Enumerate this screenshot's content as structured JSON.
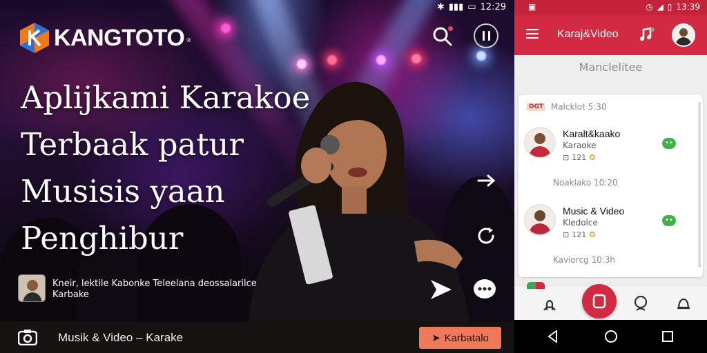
{
  "status_bar_left": {
    "time": "12:29"
  },
  "brand": {
    "name": "KANGTOTO",
    "mark": "®"
  },
  "headline": {
    "lines": [
      "Aplijkami Karakoe",
      "Terbaak patur",
      "Musisis yaan",
      "Penghibur"
    ]
  },
  "creator": {
    "line1": "Kneir, lektile Kabonke Teleelana deossalarilce",
    "line2": "Karbake"
  },
  "now_playing": {
    "title": "Musik & Video – Karake",
    "button_label": "Karbatalo"
  },
  "phone": {
    "status": {
      "time": "13:39"
    },
    "app_title": "Karaj&Video",
    "section_title": "Manclelitee",
    "card": {
      "tag": "DGT",
      "header": "Malcklot 5:30",
      "items": [
        {
          "title": "Karalt&kaako",
          "subtitle": "Karaoke",
          "meta": "121",
          "sub_label": "Noaklako 10:20"
        },
        {
          "title": "Music & Video",
          "subtitle": "Kledolce",
          "meta": "121",
          "sub_label": "Kaviorcg 10:3h"
        }
      ]
    }
  },
  "colors": {
    "accent_red": "#d12a42",
    "button_orange": "#ef7a5b",
    "online_green": "#3fb24a"
  },
  "icons": [
    "search-icon",
    "pause-icon",
    "arrow-right-icon",
    "refresh-icon",
    "share-icon",
    "more-icon",
    "camera-icon",
    "menu-icon",
    "music-note-icon",
    "home-icon",
    "record-icon",
    "friends-icon",
    "notifications-icon",
    "back-icon",
    "home-circle-icon",
    "recent-apps-icon"
  ]
}
